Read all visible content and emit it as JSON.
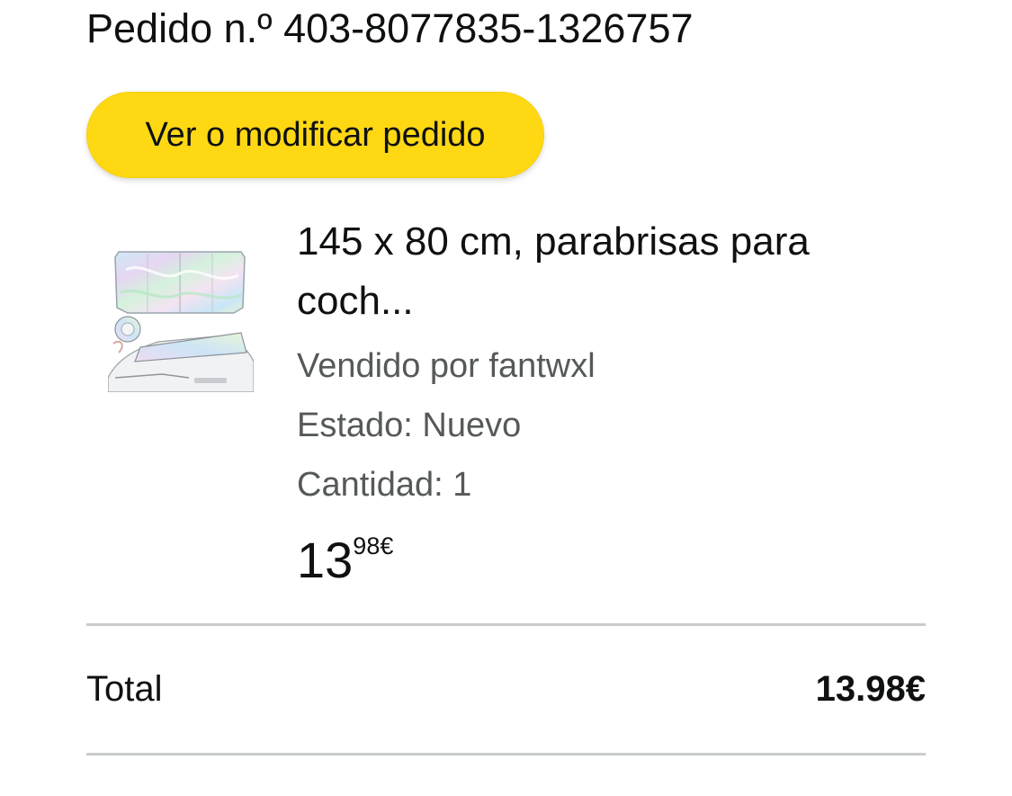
{
  "order": {
    "number_label": "Pedido n.º 403-8077835-1326757",
    "view_button_label": "Ver o modificar pedido"
  },
  "item": {
    "image_icon": "car-sunshade-product-image",
    "title": "145 x 80 cm, parabrisas para coch...",
    "seller": "Vendido por fantwxl",
    "condition": "Estado: Nuevo",
    "quantity": "Cantidad: 1",
    "price_whole": "13",
    "price_fraction": "98€"
  },
  "summary": {
    "total_label": "Total",
    "total_value": "13.98€"
  },
  "colors": {
    "button_yellow": "#ffd814",
    "text_primary": "#0f1111",
    "text_secondary": "#565959",
    "divider": "#c9cccc"
  }
}
